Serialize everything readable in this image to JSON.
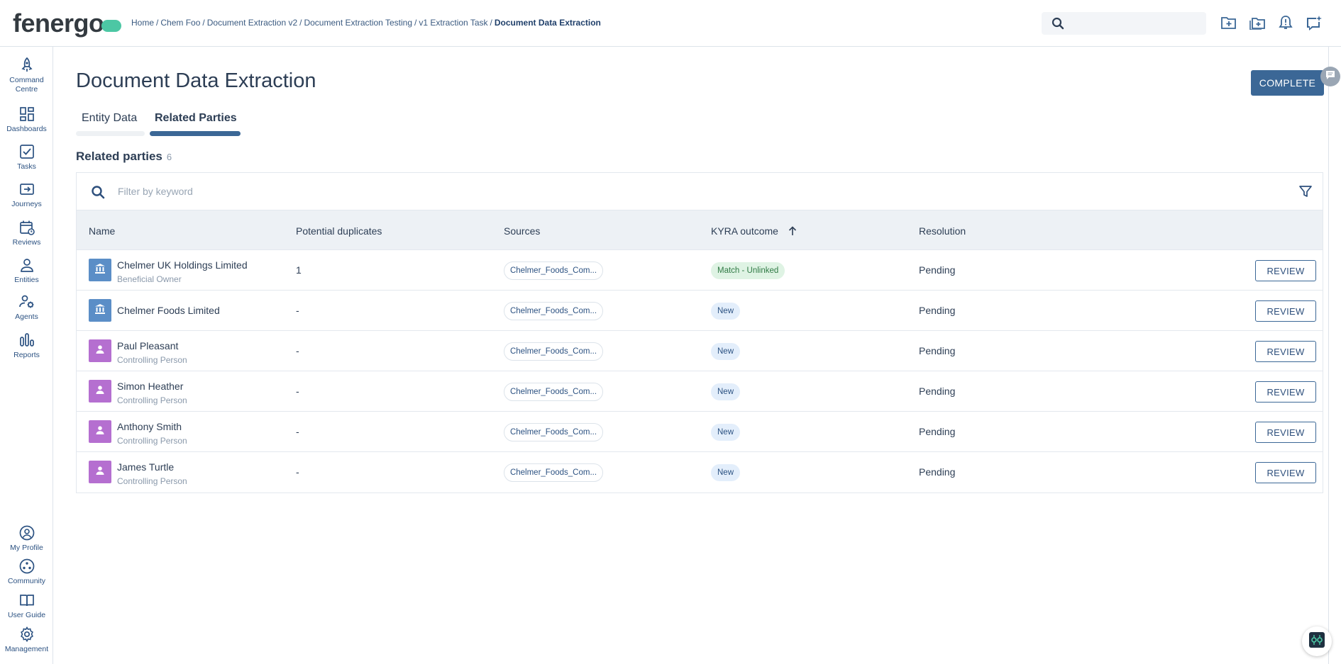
{
  "app": {
    "logo_text": "fenergo"
  },
  "breadcrumb": {
    "items": [
      "Home",
      "Chem Foo",
      "Document Extraction v2",
      "Document Extraction Testing",
      "v1 Extraction Task"
    ],
    "current": "Document Data Extraction",
    "separator": "/"
  },
  "sidebar": {
    "items": [
      {
        "label_line1": "Command",
        "label_line2": "Centre",
        "icon": "rocket-icon"
      },
      {
        "label_line1": "Dashboards",
        "icon": "dashboard-grid-icon"
      },
      {
        "label_line1": "Tasks",
        "icon": "task-check-icon"
      },
      {
        "label_line1": "Journeys",
        "icon": "journey-icon"
      },
      {
        "label_line1": "Reviews",
        "icon": "calendar-review-icon"
      },
      {
        "label_line1": "Entities",
        "icon": "entity-person-icon"
      },
      {
        "label_line1": "Agents",
        "icon": "agent-gear-icon"
      },
      {
        "label_line1": "Reports",
        "icon": "bar-chart-icon"
      }
    ],
    "bottom_items": [
      {
        "label": "My Profile",
        "icon": "profile-icon"
      },
      {
        "label": "Community",
        "icon": "community-icon"
      },
      {
        "label": "User Guide",
        "icon": "book-icon"
      },
      {
        "label": "Management",
        "icon": "settings-gear-icon"
      }
    ]
  },
  "page": {
    "title": "Document Data Extraction",
    "complete_label": "COMPLETE"
  },
  "tabs": [
    {
      "label": "Entity Data",
      "active": false
    },
    {
      "label": "Related Parties",
      "active": true
    }
  ],
  "section": {
    "title": "Related parties",
    "count": "6"
  },
  "filter": {
    "placeholder": "Filter by keyword"
  },
  "table": {
    "headers": {
      "name": "Name",
      "duplicates": "Potential duplicates",
      "sources": "Sources",
      "kyra": "KYRA outcome",
      "resolution": "Resolution"
    },
    "rows": [
      {
        "name": "Chelmer UK Holdings Limited",
        "role": "Beneficial Owner",
        "type": "org",
        "duplicates": "1",
        "source": "Chelmer_Foods_Com...",
        "kyra": "Match - Unlinked",
        "kyra_type": "match",
        "resolution": "Pending",
        "action": "REVIEW"
      },
      {
        "name": "Chelmer Foods Limited",
        "role": "",
        "type": "org",
        "duplicates": "-",
        "source": "Chelmer_Foods_Com...",
        "kyra": "New",
        "kyra_type": "new",
        "resolution": "Pending",
        "action": "REVIEW"
      },
      {
        "name": "Paul Pleasant",
        "role": "Controlling Person",
        "type": "person",
        "duplicates": "-",
        "source": "Chelmer_Foods_Com...",
        "kyra": "New",
        "kyra_type": "new",
        "resolution": "Pending",
        "action": "REVIEW"
      },
      {
        "name": "Simon Heather",
        "role": "Controlling Person",
        "type": "person",
        "duplicates": "-",
        "source": "Chelmer_Foods_Com...",
        "kyra": "New",
        "kyra_type": "new",
        "resolution": "Pending",
        "action": "REVIEW"
      },
      {
        "name": "Anthony Smith",
        "role": "Controlling Person",
        "type": "person",
        "duplicates": "-",
        "source": "Chelmer_Foods_Com...",
        "kyra": "New",
        "kyra_type": "new",
        "resolution": "Pending",
        "action": "REVIEW"
      },
      {
        "name": "James Turtle",
        "role": "Controlling Person",
        "type": "person",
        "duplicates": "-",
        "source": "Chelmer_Foods_Com...",
        "kyra": "New",
        "kyra_type": "new",
        "resolution": "Pending",
        "action": "REVIEW"
      }
    ]
  },
  "colors": {
    "primary": "#3b6796",
    "org_avatar": "#5b8ec7",
    "person_avatar": "#b56fd0",
    "match_chip_bg": "#dff3e4",
    "new_chip_bg": "#e3eefb",
    "logo_accent": "#4cc7a4"
  }
}
